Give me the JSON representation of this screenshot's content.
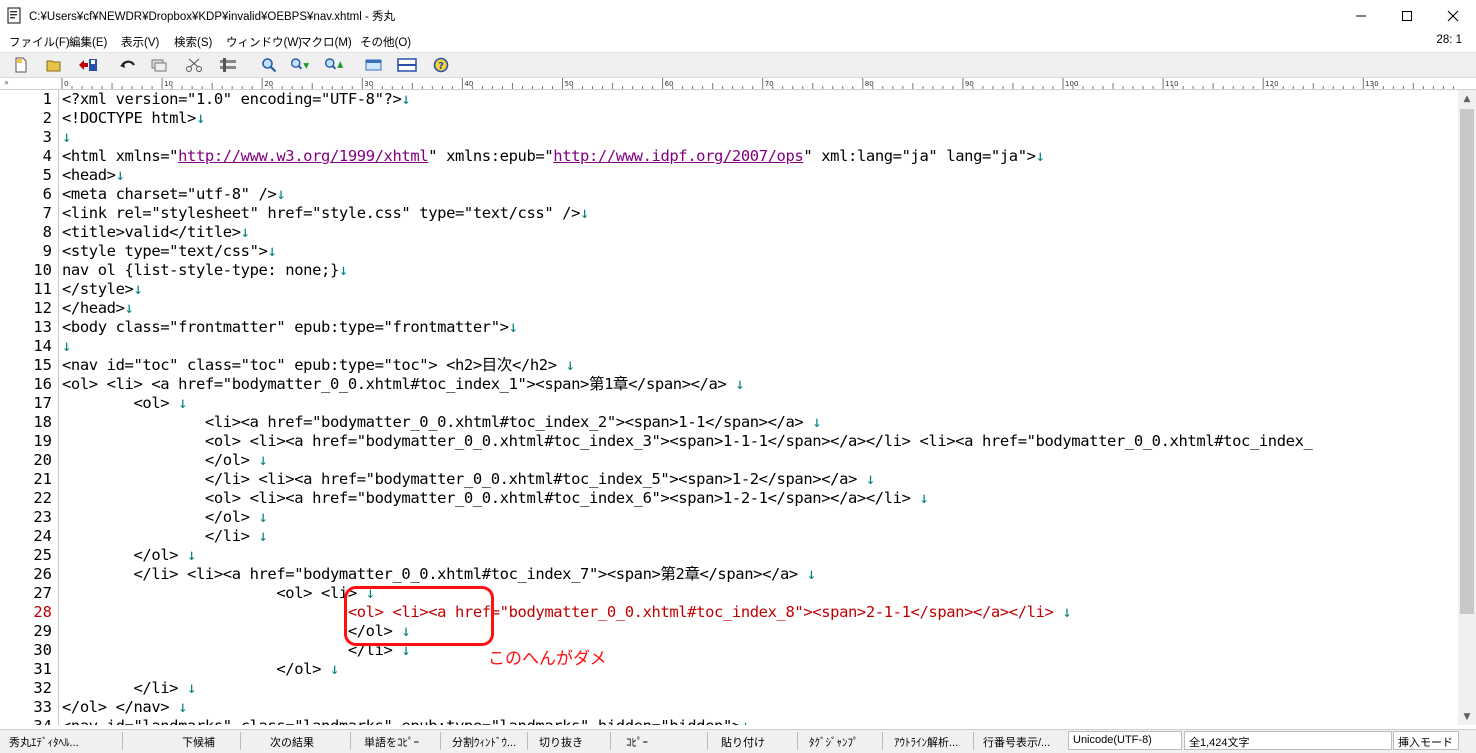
{
  "window": {
    "title": "C:¥Users¥cf¥NEWDR¥Dropbox¥KDP¥invalid¥OEBPS¥nav.xhtml - 秀丸",
    "app_icon": "document-icon"
  },
  "menu": {
    "items": [
      "ファイル(F)",
      "編集(E)",
      "表示(V)",
      "検索(S)",
      "ウィンドウ(W)",
      "マクロ(M)",
      "その他(O)"
    ],
    "cursor_position": "28: 1"
  },
  "toolbar": {
    "icons": [
      "new-file-icon",
      "open-folder-icon",
      "save-icon",
      "undo-icon",
      "copy-icon",
      "cut-icon",
      "paste-icon",
      "search-icon",
      "search-down-icon",
      "search-up-icon",
      "window-list-icon",
      "split-window-icon",
      "help-icon"
    ]
  },
  "ruler": {
    "marker": "»",
    "labels": [
      "0",
      "10",
      "20",
      "30",
      "40",
      "50",
      "60",
      "70",
      "80",
      "90",
      "100",
      "110",
      "120",
      "130",
      "140"
    ]
  },
  "editor": {
    "lines": [
      {
        "n": "1",
        "segs": [
          {
            "t": "<?xml version=\"1.0\" encoding=\"UTF-8\"?>"
          },
          {
            "t": "↓",
            "c": "eol"
          }
        ]
      },
      {
        "n": "2",
        "segs": [
          {
            "t": "<!DOCTYPE html>"
          },
          {
            "t": "↓",
            "c": "eol"
          }
        ]
      },
      {
        "n": "3",
        "segs": [
          {
            "t": "↓",
            "c": "eol"
          }
        ]
      },
      {
        "n": "4",
        "segs": [
          {
            "t": "<html xmlns=\""
          },
          {
            "t": "http://www.w3.org/1999/xhtml",
            "c": "u"
          },
          {
            "t": "\" xmlns:epub=\""
          },
          {
            "t": "http://www.idpf.org/2007/ops",
            "c": "u"
          },
          {
            "t": "\" xml:lang=\"ja\" lang=\"ja\">"
          },
          {
            "t": "↓",
            "c": "eol"
          }
        ]
      },
      {
        "n": "5",
        "segs": [
          {
            "t": "<head>"
          },
          {
            "t": "↓",
            "c": "eol"
          }
        ]
      },
      {
        "n": "6",
        "segs": [
          {
            "t": "<meta charset=\"utf-8\" />"
          },
          {
            "t": "↓",
            "c": "eol"
          }
        ]
      },
      {
        "n": "7",
        "segs": [
          {
            "t": "<link rel=\"stylesheet\" href=\"style.css\" type=\"text/css\" />"
          },
          {
            "t": "↓",
            "c": "eol"
          }
        ]
      },
      {
        "n": "8",
        "segs": [
          {
            "t": "<title>valid</title>"
          },
          {
            "t": "↓",
            "c": "eol"
          }
        ]
      },
      {
        "n": "9",
        "segs": [
          {
            "t": "<style type=\"text/css\">"
          },
          {
            "t": "↓",
            "c": "eol"
          }
        ]
      },
      {
        "n": "10",
        "segs": [
          {
            "t": "nav ol {list-style-type: none;}"
          },
          {
            "t": "↓",
            "c": "eol"
          }
        ]
      },
      {
        "n": "11",
        "segs": [
          {
            "t": "</style>"
          },
          {
            "t": "↓",
            "c": "eol"
          }
        ]
      },
      {
        "n": "12",
        "segs": [
          {
            "t": "</head>"
          },
          {
            "t": "↓",
            "c": "eol"
          }
        ]
      },
      {
        "n": "13",
        "segs": [
          {
            "t": "<body class=\"frontmatter\" epub:type=\"frontmatter\">"
          },
          {
            "t": "↓",
            "c": "eol"
          }
        ]
      },
      {
        "n": "14",
        "segs": [
          {
            "t": "↓",
            "c": "eol"
          }
        ]
      },
      {
        "n": "15",
        "segs": [
          {
            "t": "<nav id=\"toc\" class=\"toc\" epub:type=\"toc\"> <h2>目次</h2> "
          },
          {
            "t": "↓",
            "c": "eol"
          }
        ]
      },
      {
        "n": "16",
        "segs": [
          {
            "t": "<ol> <li> <a href=\"bodymatter_0_0.xhtml#toc_index_1\"><span>第1章</span></a> "
          },
          {
            "t": "↓",
            "c": "eol"
          }
        ]
      },
      {
        "n": "17",
        "segs": [
          {
            "t": "        <ol> "
          },
          {
            "t": "↓",
            "c": "eol"
          }
        ]
      },
      {
        "n": "18",
        "segs": [
          {
            "t": "                <li><a href=\"bodymatter_0_0.xhtml#toc_index_2\"><span>1-1</span></a> "
          },
          {
            "t": "↓",
            "c": "eol"
          }
        ]
      },
      {
        "n": "19",
        "segs": [
          {
            "t": "                <ol> <li><a href=\"bodymatter_0_0.xhtml#toc_index_3\"><span>1-1-1</span></a></li> <li><a href=\"bodymatter_0_0.xhtml#toc_index_"
          }
        ]
      },
      {
        "n": "20",
        "segs": [
          {
            "t": "                </ol> "
          },
          {
            "t": "↓",
            "c": "eol"
          }
        ]
      },
      {
        "n": "21",
        "segs": [
          {
            "t": "                </li> <li><a href=\"bodymatter_0_0.xhtml#toc_index_5\"><span>1-2</span></a> "
          },
          {
            "t": "↓",
            "c": "eol"
          }
        ]
      },
      {
        "n": "22",
        "segs": [
          {
            "t": "                <ol> <li><a href=\"bodymatter_0_0.xhtml#toc_index_6\"><span>1-2-1</span></a></li> "
          },
          {
            "t": "↓",
            "c": "eol"
          }
        ]
      },
      {
        "n": "23",
        "segs": [
          {
            "t": "                </ol> "
          },
          {
            "t": "↓",
            "c": "eol"
          }
        ]
      },
      {
        "n": "24",
        "segs": [
          {
            "t": "                </li> "
          },
          {
            "t": "↓",
            "c": "eol"
          }
        ]
      },
      {
        "n": "25",
        "segs": [
          {
            "t": "        </ol> "
          },
          {
            "t": "↓",
            "c": "eol"
          }
        ]
      },
      {
        "n": "26",
        "segs": [
          {
            "t": "        </li> <li><a href=\"bodymatter_0_0.xhtml#toc_index_7\"><span>第2章</span></a> "
          },
          {
            "t": "↓",
            "c": "eol"
          }
        ]
      },
      {
        "n": "27",
        "segs": [
          {
            "t": "                        <ol> <li> "
          },
          {
            "t": "↓",
            "c": "eol"
          }
        ]
      },
      {
        "n": "28",
        "cursor": true,
        "segs": [
          {
            "t": "                                <ol> <li><a href=\"bodymatter_0_0.xhtml#toc_index_8\"><span>2-1-1</span></a></li> "
          },
          {
            "t": "↓",
            "c": "eol"
          }
        ]
      },
      {
        "n": "29",
        "segs": [
          {
            "t": "                                </ol> "
          },
          {
            "t": "↓",
            "c": "eol"
          }
        ]
      },
      {
        "n": "30",
        "segs": [
          {
            "t": "                                </li> "
          },
          {
            "t": "↓",
            "c": "eol"
          }
        ]
      },
      {
        "n": "31",
        "segs": [
          {
            "t": "                        </ol> "
          },
          {
            "t": "↓",
            "c": "eol"
          }
        ]
      },
      {
        "n": "32",
        "segs": [
          {
            "t": "        </li> "
          },
          {
            "t": "↓",
            "c": "eol"
          }
        ]
      },
      {
        "n": "33",
        "segs": [
          {
            "t": "</ol> </nav> "
          },
          {
            "t": "↓",
            "c": "eol"
          }
        ]
      },
      {
        "n": "34",
        "segs": [
          {
            "t": "<nav id=\"landmarks\" class=\"landmarks\" epub:type=\"landmarks\" hidden=\"hidden\">"
          },
          {
            "t": "↓",
            "c": "eol"
          }
        ]
      }
    ]
  },
  "annotation": {
    "text": "このへんがダメ",
    "color": "#ff1010"
  },
  "statusbar": {
    "items": [
      "秀丸ｴﾃﾞｨﾀﾍﾙ...",
      "下候補",
      "次の結果",
      "単語をｺﾋﾟｰ",
      "分割ｳｨﾝﾄﾞｳ...",
      "切り抜き",
      "ｺﾋﾟｰ",
      "貼り付け",
      "ﾀｸﾞｼﾞｬﾝﾌﾟ",
      "ｱｳﾄﾗｲﾝ解析...",
      "行番号表示/..."
    ],
    "encoding": "Unicode(UTF-8)",
    "char_count": "全1,424文字",
    "mode": "挿入モード"
  }
}
